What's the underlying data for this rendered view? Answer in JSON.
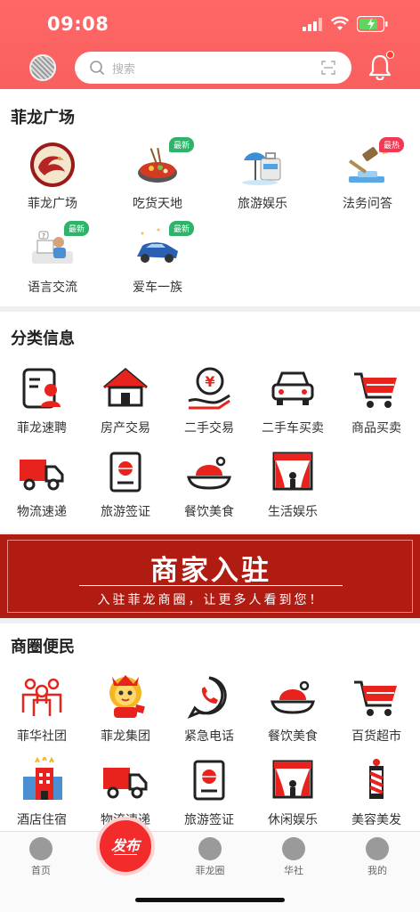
{
  "status_bar": {
    "time": "09:08"
  },
  "header": {
    "search_placeholder": "搜索"
  },
  "section_plaza": {
    "title": "菲龙广场",
    "items": [
      {
        "label": "菲龙广场",
        "icon": "dragon-logo-icon",
        "badge": ""
      },
      {
        "label": "吃货天地",
        "icon": "hotpot-icon",
        "badge": "最新"
      },
      {
        "label": "旅游娱乐",
        "icon": "travel-icon",
        "badge": ""
      },
      {
        "label": "法务问答",
        "icon": "gavel-icon",
        "badge": "最热"
      },
      {
        "label": "语言交流",
        "icon": "study-icon",
        "badge": "最新"
      },
      {
        "label": "爱车一族",
        "icon": "car-icon",
        "badge": "最新"
      }
    ]
  },
  "section_classified": {
    "title": "分类信息",
    "items": [
      {
        "label": "菲龙速聘",
        "icon": "resume-icon"
      },
      {
        "label": "房产交易",
        "icon": "house-icon"
      },
      {
        "label": "二手交易",
        "icon": "yen-hand-icon"
      },
      {
        "label": "二手车买卖",
        "icon": "car-front-icon"
      },
      {
        "label": "商品买卖",
        "icon": "cart-icon"
      },
      {
        "label": "物流速递",
        "icon": "truck-icon"
      },
      {
        "label": "旅游签证",
        "icon": "passport-icon"
      },
      {
        "label": "餐饮美食",
        "icon": "dish-icon"
      },
      {
        "label": "生活娱乐",
        "icon": "theater-icon"
      }
    ]
  },
  "banner": {
    "title": "商家入驻",
    "subtitle": "入驻菲龙商圈，让更多人看到您！"
  },
  "section_business": {
    "title": "商圈便民",
    "items": [
      {
        "label": "菲华社团",
        "icon": "community-icon"
      },
      {
        "label": "菲龙集团",
        "icon": "lion-mascot-icon"
      },
      {
        "label": "紧急电话",
        "icon": "phone-icon"
      },
      {
        "label": "餐饮美食",
        "icon": "dish-icon"
      },
      {
        "label": "百货超市",
        "icon": "cart-icon"
      },
      {
        "label": "酒店住宿",
        "icon": "hotel-icon"
      },
      {
        "label": "物流速递",
        "icon": "truck-icon"
      },
      {
        "label": "旅游签证",
        "icon": "passport-icon"
      },
      {
        "label": "休闲娱乐",
        "icon": "theater-icon"
      },
      {
        "label": "美容美发",
        "icon": "barber-pole-icon"
      }
    ]
  },
  "tabbar": {
    "tabs": [
      {
        "label": "首页",
        "icon": "home-icon"
      },
      {
        "label": "菲龙圈",
        "icon": "circle-icon"
      },
      {
        "label": "华社",
        "icon": "community-tab-icon"
      },
      {
        "label": "我的",
        "icon": "profile-icon"
      }
    ],
    "publish_label": "发布"
  },
  "colors": {
    "brand_red": "#f95f5f",
    "icon_red": "#e8231d",
    "badge_green": "#2fb36a",
    "badge_hot": "#f03a55"
  }
}
